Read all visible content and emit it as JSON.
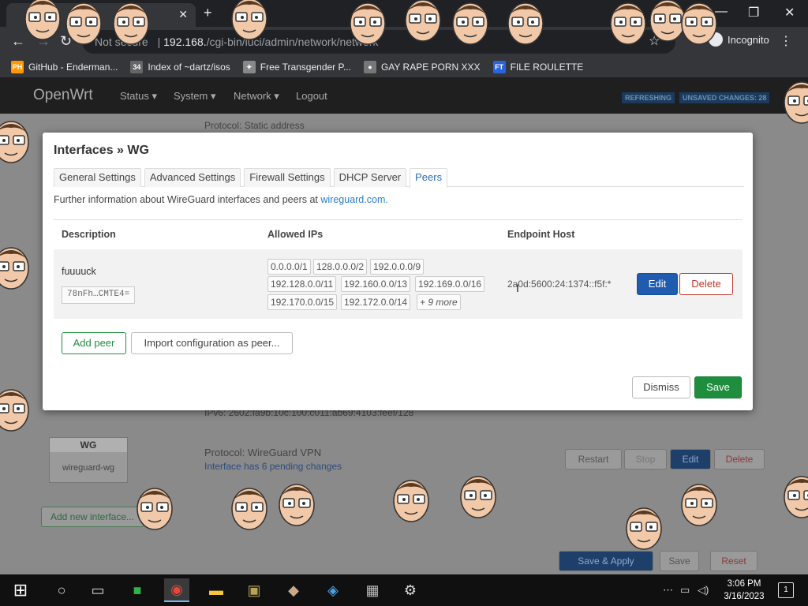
{
  "browser": {
    "tab_title": "",
    "address_prefix": "Not secure",
    "address_host": "192.168.",
    "address_path": "/cgi-bin/luci/admin/network/network",
    "incognito_label": "Incognito",
    "bookmarks": [
      {
        "icon": "PH",
        "label": "GitHub - Enderman...",
        "color": "#ff9900"
      },
      {
        "icon": "34",
        "label": "Index of ~dartz/isos",
        "color": "#666"
      },
      {
        "icon": "✦",
        "label": "Free Transgender P...",
        "color": "#888"
      },
      {
        "icon": "●",
        "label": "GAY RAPE PORN XXX",
        "color": "#777"
      },
      {
        "icon": "FT",
        "label": "FILE ROULETTE",
        "color": "#2a64d6"
      }
    ]
  },
  "openwrt": {
    "brand": "OpenWrt",
    "menu": [
      "Status ▾",
      "System ▾",
      "Network ▾",
      "Logout"
    ],
    "badges": [
      "REFRESHING",
      "UNSAVED CHANGES: 28"
    ],
    "bg_protocol_top": "Protocol: Static address",
    "bg_ipv6": "IPv6: 2602:fa9b:10c:100:c011:ab69:4103:feef/128",
    "bg_iface_name": "WG",
    "bg_iface_dev": "wireguard-wg",
    "bg_protocol_wg": "Protocol: WireGuard VPN",
    "bg_pending": "Interface has 6 pending changes",
    "bg_buttons": [
      "Restart",
      "Stop",
      "Edit",
      "Delete"
    ],
    "bg_add_interface": "Add new interface...",
    "bg_save_apply": "Save & Apply",
    "bg_save": "Save",
    "bg_reset": "Reset"
  },
  "modal": {
    "title": "Interfaces » WG",
    "tabs": [
      "General Settings",
      "Advanced Settings",
      "Firewall Settings",
      "DHCP Server",
      "Peers"
    ],
    "active_tab_index": 4,
    "info_text": "Further information about WireGuard interfaces and peers at ",
    "info_link": "wireguard.com.",
    "columns": [
      "Description",
      "Allowed IPs",
      "Endpoint Host"
    ],
    "peer": {
      "description": "fuuuuck",
      "public_key": "78nFh…CMTE4=",
      "allowed_ips": [
        "0.0.0.0/1",
        "128.0.0.0/2",
        "192.0.0.0/9",
        "192.128.0.0/11",
        "192.160.0.0/13",
        "192.169.0.0/16",
        "192.170.0.0/15",
        "192.172.0.0/14"
      ],
      "more_ips": "+ 9 more",
      "endpoint": "2a0d:5600:24:1374::f5f:*",
      "edit_label": "Edit",
      "delete_label": "Delete"
    },
    "add_peer_label": "Add peer",
    "import_label": "Import configuration as peer...",
    "dismiss_label": "Dismiss",
    "save_label": "Save"
  },
  "taskbar": {
    "time": "3:06 PM",
    "date": "3/16/2023",
    "notification_count": "1"
  }
}
